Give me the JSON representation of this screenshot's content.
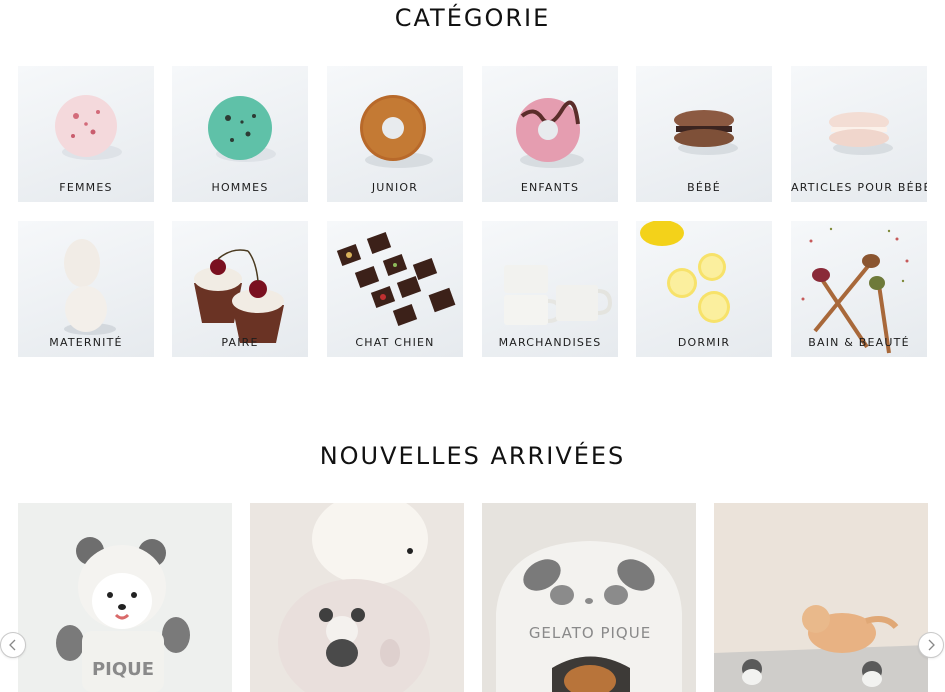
{
  "categories": {
    "title": "CATÉGORIE",
    "items": [
      {
        "label": "FEMMES",
        "image": "strawberry-ice-cream-scoop"
      },
      {
        "label": "HOMMES",
        "image": "mint-chocolate-chip-ice-cream-scoop"
      },
      {
        "label": "JUNIOR",
        "image": "plain-donut"
      },
      {
        "label": "ENFANTS",
        "image": "pink-glazed-donut"
      },
      {
        "label": "BÉBÉ",
        "image": "chocolate-macaron"
      },
      {
        "label": "ARTICLES POUR BÉBÉ",
        "image": "pink-macaron"
      },
      {
        "label": "MATERNITÉ",
        "image": "two-eggs"
      },
      {
        "label": "PAIRE",
        "image": "two-cherry-cupcakes"
      },
      {
        "label": "CHAT CHIEN",
        "image": "chocolate-pieces"
      },
      {
        "label": "MARCHANDISES",
        "image": "white-mugs"
      },
      {
        "label": "DORMIR",
        "image": "lemon-slices"
      },
      {
        "label": "BAIN & BEAUTÉ",
        "image": "wooden-spoons-with-spices"
      }
    ]
  },
  "new_arrivals": {
    "title": "NOUVELLES ARRIVÉES",
    "products": [
      {
        "image": "white-dog-in-panda-hoodie",
        "print_text": "PIQUE"
      },
      {
        "image": "fluffy-dog-in-panda-sweater",
        "print_text": ""
      },
      {
        "image": "panda-pet-house-with-puppy",
        "print_text": "GELATO PIQUE"
      },
      {
        "image": "cat-on-panda-blanket",
        "print_text": ""
      }
    ]
  },
  "carousel": {
    "prev_icon": "chevron-left-icon",
    "next_icon": "chevron-right-icon"
  }
}
